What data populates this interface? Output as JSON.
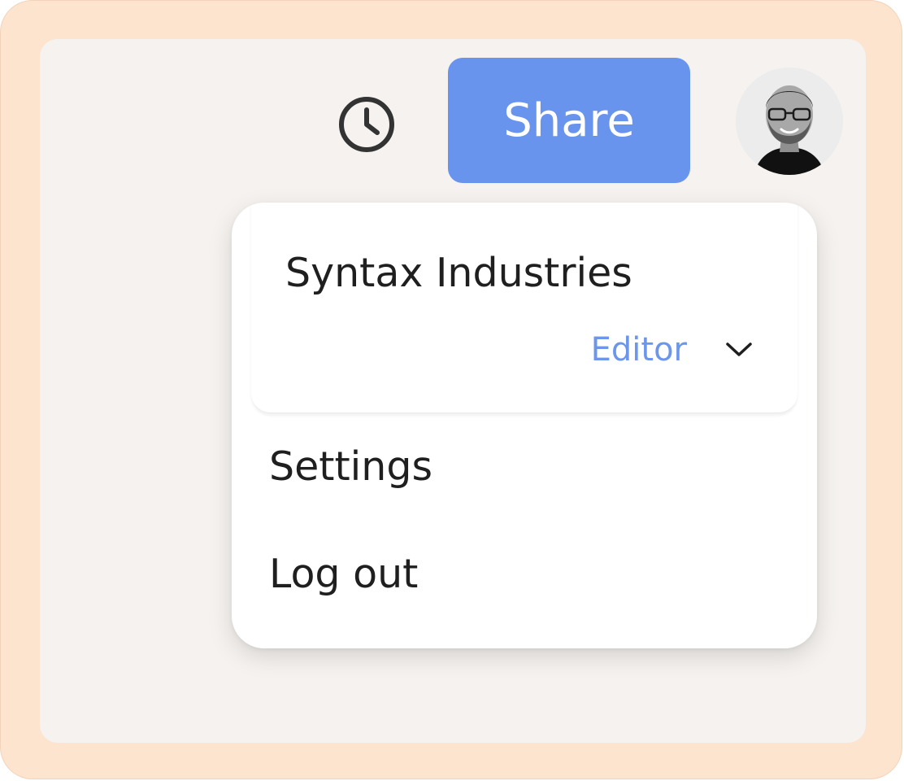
{
  "toolbar": {
    "history_icon": "clock-icon",
    "share_label": "Share",
    "avatar_icon": "user-avatar",
    "share_color": "#6894ed"
  },
  "account_menu": {
    "organization": "Syntax Industries",
    "role": "Editor",
    "role_icon": "chevron-down-icon",
    "role_color": "#6b96ec",
    "items": [
      {
        "label": "Settings"
      },
      {
        "label": "Log out"
      }
    ]
  }
}
